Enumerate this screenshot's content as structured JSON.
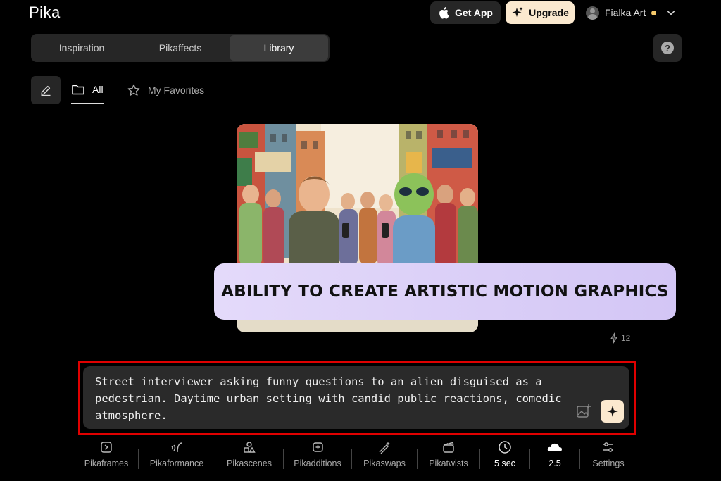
{
  "app": {
    "logo": "Pika"
  },
  "header": {
    "get_app_label": "Get App",
    "upgrade_label": "Upgrade",
    "user_name": "Fialka Art"
  },
  "main_tabs": [
    {
      "label": "Inspiration"
    },
    {
      "label": "Pikaffects"
    },
    {
      "label": "Library"
    }
  ],
  "help_label": "?",
  "sub_tabs": {
    "all_label": "All",
    "favorites_label": "My Favorites"
  },
  "card": {
    "count": "12"
  },
  "banner": {
    "text": "ABILITY TO CREATE ARTISTIC MOTION GRAPHICS"
  },
  "prompt": {
    "text": "Street interviewer asking funny questions to an alien disguised as a pedestrian. Daytime urban setting with candid public reactions, comedic atmosphere."
  },
  "toolbar": [
    {
      "label": "Pikaframes",
      "icon": "frames-icon"
    },
    {
      "label": "Pikaformance",
      "icon": "performance-icon"
    },
    {
      "label": "Pikascenes",
      "icon": "scenes-icon"
    },
    {
      "label": "Pikadditions",
      "icon": "additions-icon"
    },
    {
      "label": "Pikaswaps",
      "icon": "swaps-icon"
    },
    {
      "label": "Pikatwists",
      "icon": "twists-icon"
    },
    {
      "label": "5 sec",
      "icon": "clock-icon"
    },
    {
      "label": "2.5",
      "icon": "cloud-icon"
    },
    {
      "label": "Settings",
      "icon": "sliders-icon"
    }
  ],
  "colors": {
    "accent": "#fbe9cf",
    "highlight_outline": "#e00000",
    "banner": "#ddd2f8"
  }
}
